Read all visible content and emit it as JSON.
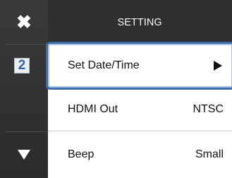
{
  "header": {
    "title": "SETTING"
  },
  "sidebar": {
    "close_icon": "close-icon",
    "page_number": "2",
    "down_icon": "triangle-down-icon"
  },
  "menu": {
    "items": [
      {
        "label": "Set Date/Time",
        "value": "",
        "icon": "triangle-right-icon",
        "selected": true
      },
      {
        "label": "HDMI Out",
        "value": "NTSC",
        "selected": false
      },
      {
        "label": "Beep",
        "value": "Small",
        "selected": false
      }
    ]
  },
  "colors": {
    "dark_panel": "#2f2f2f",
    "selection": "#3e6aa8",
    "page_number": "#3a62a8"
  }
}
